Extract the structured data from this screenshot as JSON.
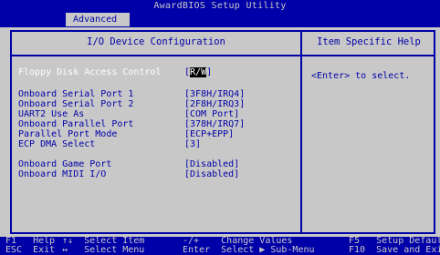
{
  "window": {
    "title": "AwardBIOS Setup Utility"
  },
  "tabs": {
    "active": "Advanced"
  },
  "main": {
    "title": "I/O Device Configuration"
  },
  "help_panel": {
    "title": "Item Specific Help",
    "text": "<Enter> to select."
  },
  "settings": [
    {
      "label": "Floppy Disk Access Control",
      "value_pre": "[",
      "value_sel": "R/W",
      "value_post": "]",
      "highlighted": true
    },
    {
      "label": "Onboard Serial Port 1",
      "value": "[3F8H/IRQ4]"
    },
    {
      "label": "Onboard Serial Port 2",
      "value": "[2F8H/IRQ3]"
    },
    {
      "label": "UART2 Use As",
      "value": "[COM Port]"
    },
    {
      "label": "Onboard Parallel Port",
      "value": "[378H/IRQ7]"
    },
    {
      "label": "Parallel Port Mode",
      "value": "[ECP+EPP]"
    },
    {
      "label": "ECP DMA Select",
      "value": "[3]"
    },
    {
      "label": "Onboard Game Port",
      "value": "[Disabled]"
    },
    {
      "label": "Onboard MIDI I/O",
      "value": "[Disabled]"
    }
  ],
  "footer": {
    "row1": [
      {
        "key": "F1",
        "desc": "Help"
      },
      {
        "key": "↑↓",
        "desc": "Select Item"
      },
      {
        "key": "-/+",
        "desc": "Change Values"
      },
      {
        "key": "F5",
        "desc": "Setup Defaults"
      }
    ],
    "row2": [
      {
        "key": "ESC",
        "desc": "Exit"
      },
      {
        "key": "↔",
        "desc": "Select Menu"
      },
      {
        "key": "Enter",
        "desc": "Select ▶ Sub-Menu"
      },
      {
        "key": "F10",
        "desc": "Save and Exit"
      }
    ]
  },
  "colors": {
    "background": "#c8c8c8",
    "accent": "#0000a8",
    "highlight_text": "#ffffff",
    "selection_bg": "#000000"
  }
}
